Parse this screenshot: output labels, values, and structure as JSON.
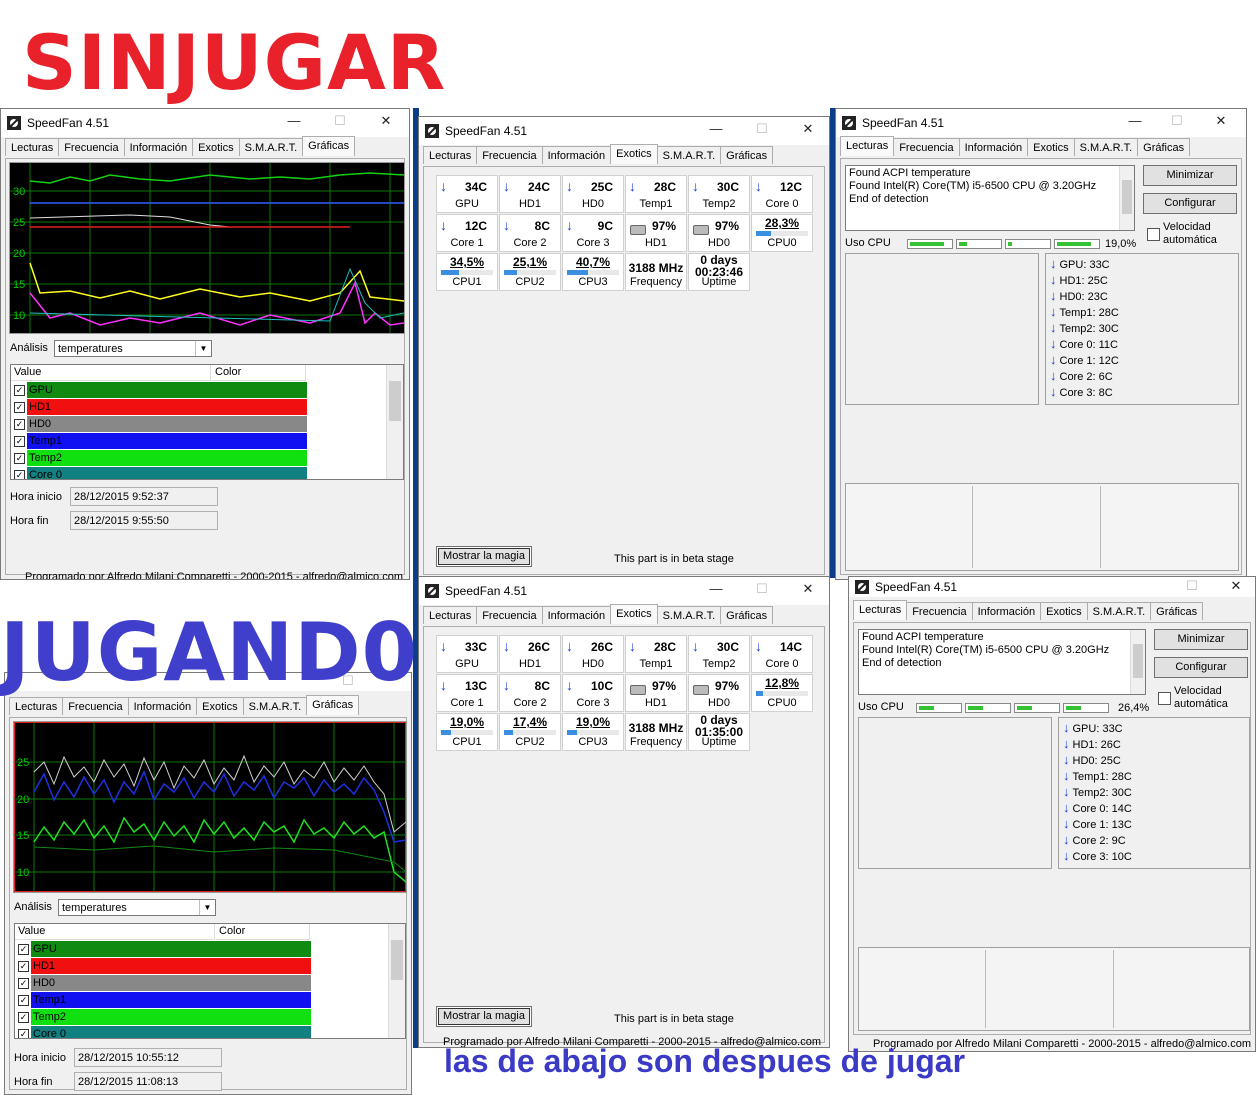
{
  "labels": {
    "top_title": "SINJUGAR",
    "bottom_title": "JUGAND0",
    "caption": "las de abajo son despues de jugar"
  },
  "colors": {
    "graph_bg": "#000000",
    "grid": "#0a8a0a",
    "accent_blue": "#3c8ee0",
    "usage_green": "#35c335",
    "title_red": "#e8212b",
    "title_blue": "#3f3fcc"
  },
  "app": {
    "title": "SpeedFan 4.51",
    "tabs": [
      "Lecturas",
      "Frecuencia",
      "Información",
      "Exotics",
      "S.M.A.R.T.",
      "Gráficas"
    ],
    "window_buttons": {
      "minimize": "—",
      "maximize": "☐",
      "close": "✕"
    },
    "footer": "Programado por Alfredo Milani Comparetti - 2000-2015 - alfredo@almico.com"
  },
  "graficas_before": {
    "y_ticks": [
      "30",
      "25",
      "20",
      "15",
      "10"
    ],
    "analysis_label": "Análisis",
    "analysis_value": "temperatures",
    "list_headers": [
      "Value",
      "Color"
    ],
    "list_items": [
      {
        "name": "GPU",
        "color": "#108a10"
      },
      {
        "name": "HD1",
        "color": "#f01010"
      },
      {
        "name": "HD0",
        "color": "#888888"
      },
      {
        "name": "Temp1",
        "color": "#1010f0"
      },
      {
        "name": "Temp2",
        "color": "#10e010"
      },
      {
        "name": "Core 0",
        "color": "#108080"
      }
    ],
    "hora_inicio_label": "Hora inicio",
    "hora_inicio": "28/12/2015 9:52:37",
    "hora_fin_label": "Hora fin",
    "hora_fin": "28/12/2015 9:55:50"
  },
  "graficas_after": {
    "y_ticks": [
      "25",
      "20",
      "15",
      "10"
    ],
    "analysis_label": "Análisis",
    "analysis_value": "temperatures",
    "list_headers": [
      "Value",
      "Color"
    ],
    "list_items": [
      {
        "name": "GPU",
        "color": "#108a10"
      },
      {
        "name": "HD1",
        "color": "#f01010"
      },
      {
        "name": "HD0",
        "color": "#888888"
      },
      {
        "name": "Temp1",
        "color": "#1010f0"
      },
      {
        "name": "Temp2",
        "color": "#10e010"
      },
      {
        "name": "Core 0",
        "color": "#108080"
      }
    ],
    "hora_inicio_label": "Hora inicio",
    "hora_inicio": "28/12/2015 10:55:12",
    "hora_fin_label": "Hora fin",
    "hora_fin": "28/12/2015 11:08:13"
  },
  "exotics_before": {
    "row1": [
      {
        "val": "34C",
        "name": "GPU"
      },
      {
        "val": "24C",
        "name": "HD1"
      },
      {
        "val": "25C",
        "name": "HD0"
      },
      {
        "val": "28C",
        "name": "Temp1"
      },
      {
        "val": "30C",
        "name": "Temp2"
      },
      {
        "val": "12C",
        "name": "Core 0"
      }
    ],
    "row2": [
      {
        "val": "12C",
        "name": "Core 1"
      },
      {
        "val": "8C",
        "name": "Core 2"
      },
      {
        "val": "9C",
        "name": "Core 3"
      },
      {
        "val": "97%",
        "name": "HD1"
      },
      {
        "val": "97%",
        "name": "HD0"
      },
      {
        "pct": "28,3%",
        "fill": 0.283,
        "name": "CPU0"
      }
    ],
    "row3": [
      {
        "pct": "34,5%",
        "fill": 0.345,
        "name": "CPU1"
      },
      {
        "pct": "25,1%",
        "fill": 0.251,
        "name": "CPU2"
      },
      {
        "pct": "40,7%",
        "fill": 0.407,
        "name": "CPU3"
      },
      {
        "mid": "3188 MHz",
        "name": "Frequency"
      },
      {
        "mid": "0 days",
        "mid2": "00:23:46",
        "name": "Uptime"
      }
    ],
    "button": "Mostrar la magia",
    "beta": "This part is in beta stage"
  },
  "exotics_after": {
    "row1": [
      {
        "val": "33C",
        "name": "GPU"
      },
      {
        "val": "26C",
        "name": "HD1"
      },
      {
        "val": "26C",
        "name": "HD0"
      },
      {
        "val": "28C",
        "name": "Temp1"
      },
      {
        "val": "30C",
        "name": "Temp2"
      },
      {
        "val": "14C",
        "name": "Core 0"
      }
    ],
    "row2": [
      {
        "val": "13C",
        "name": "Core 1"
      },
      {
        "val": "8C",
        "name": "Core 2"
      },
      {
        "val": "10C",
        "name": "Core 3"
      },
      {
        "val": "97%",
        "name": "HD1"
      },
      {
        "val": "97%",
        "name": "HD0"
      },
      {
        "pct": "12,8%",
        "fill": 0.128,
        "name": "CPU0"
      }
    ],
    "row3": [
      {
        "pct": "19,0%",
        "fill": 0.19,
        "name": "CPU1"
      },
      {
        "pct": "17,4%",
        "fill": 0.174,
        "name": "CPU2"
      },
      {
        "pct": "19,0%",
        "fill": 0.19,
        "name": "CPU3"
      },
      {
        "mid": "3188 MHz",
        "name": "Frequency"
      },
      {
        "mid": "0 days",
        "mid2": "01:35:00",
        "name": "Uptime"
      }
    ],
    "button": "Mostrar la magia",
    "beta": "This part is in beta stage"
  },
  "lecturas_before": {
    "log": [
      "Found ACPI temperature",
      "Found Intel(R) Core(TM) i5-6500 CPU @ 3.20GHz",
      "End of detection"
    ],
    "minimize_button": "Minimizar",
    "configure_button": "Configurar",
    "auto_speed": "Velocidad automática",
    "uso_cpu_label": "Uso CPU",
    "uso_cpu": "19,0%",
    "cores_usage": [
      0.8,
      0.2,
      0.1,
      0.8
    ],
    "temps": [
      "GPU:   33C",
      "HD1:   25C",
      "HD0:   23C",
      "Temp1: 28C",
      "Temp2: 30C",
      "Core 0:  11C",
      "Core 1:  12C",
      "Core 2:  6C",
      "Core 3:  8C"
    ]
  },
  "lecturas_after": {
    "log": [
      "Found ACPI temperature",
      "Found Intel(R) Core(TM) i5-6500 CPU @ 3.20GHz",
      "End of detection"
    ],
    "minimize_button": "Minimizar",
    "configure_button": "Configurar",
    "auto_speed": "Velocidad automática",
    "uso_cpu_label": "Uso CPU",
    "uso_cpu": "26,4%",
    "cores_usage": [
      0.35,
      0.35,
      0.35,
      0.35
    ],
    "temps": [
      "GPU:   33C",
      "HD1:   26C",
      "HD0:   25C",
      "Temp1: 28C",
      "Temp2: 30C",
      "Core 0:  14C",
      "Core 1:  13C",
      "Core 2:  9C",
      "Core 3:  10C"
    ]
  }
}
